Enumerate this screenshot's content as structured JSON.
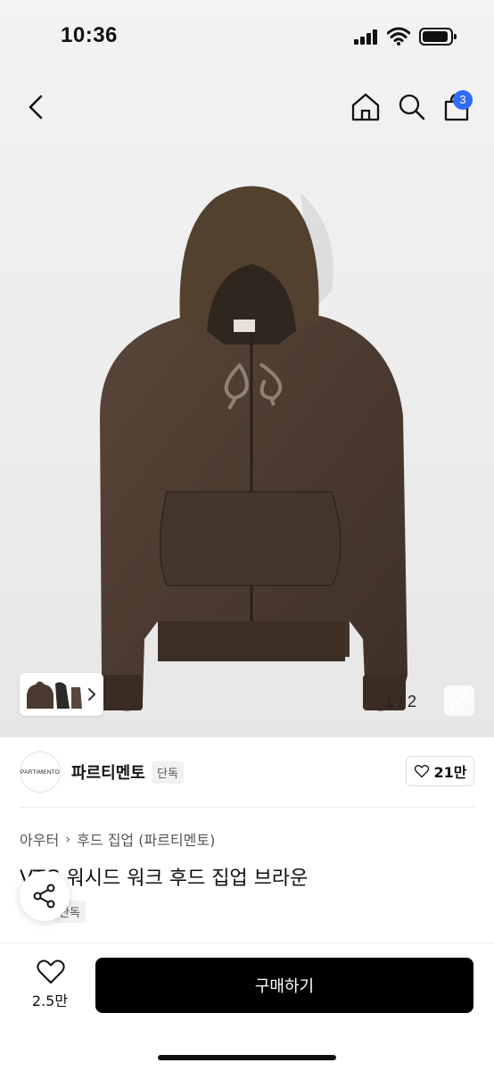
{
  "status_bar": {
    "time": "10:36",
    "icons": [
      "signal-icon",
      "wifi-icon",
      "battery-icon"
    ]
  },
  "nav": {
    "icons": [
      "back-chevron-icon",
      "home-icon",
      "search-icon",
      "cart-icon"
    ],
    "cart_badge": "3",
    "badge_color": "#2f6df6"
  },
  "gallery": {
    "page_text": "1 / 2",
    "current_page": 1,
    "total_pages": 2,
    "thumbnail_count": 3
  },
  "brand": {
    "logo_text": "PARTIMENTO",
    "name": "파르티멘토",
    "tag": "단독",
    "like_count": "21만"
  },
  "breadcrumb": {
    "category": "아우터",
    "subcategory": "후드 집업 (파르티멘토)"
  },
  "product": {
    "title": "VTG 워시드 워크 후드 집업 브라운",
    "tag": "단독",
    "image_color": "#4a3a30"
  },
  "bottom_bar": {
    "wish_count": "2.5만",
    "buy_label": "구매하기",
    "buy_color": "#000000"
  }
}
